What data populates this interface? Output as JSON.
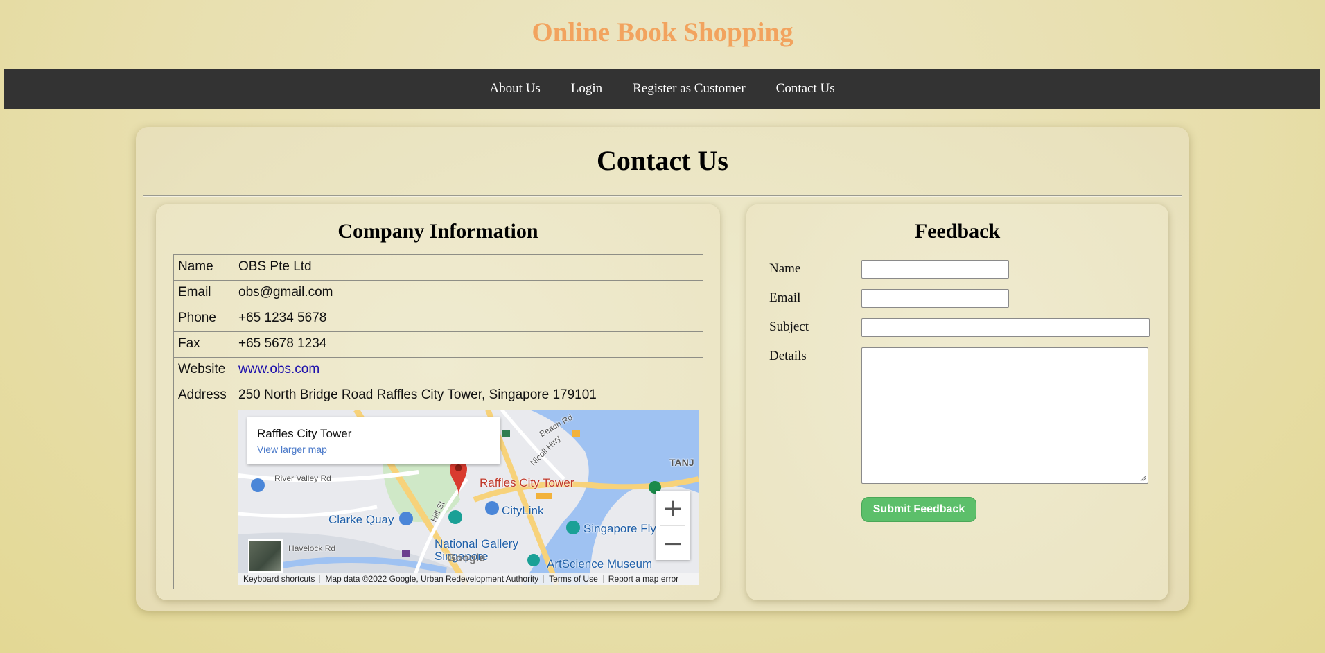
{
  "site": {
    "title": "Online Book Shopping"
  },
  "nav": {
    "items": [
      {
        "label": "About Us"
      },
      {
        "label": "Login"
      },
      {
        "label": "Register as Customer"
      },
      {
        "label": "Contact Us"
      }
    ]
  },
  "page": {
    "heading": "Contact Us"
  },
  "company": {
    "title": "Company Information",
    "rows": [
      {
        "label": "Name",
        "value": "OBS Pte Ltd"
      },
      {
        "label": "Email",
        "value": "obs@gmail.com"
      },
      {
        "label": "Phone",
        "value": "+65 1234 5678"
      },
      {
        "label": "Fax",
        "value": "+65 5678 1234"
      },
      {
        "label": "Website",
        "value": "www.obs.com"
      },
      {
        "label": "Address",
        "value": "250 North Bridge Road Raffles City Tower, Singapore 179101"
      }
    ]
  },
  "map": {
    "place_name": "Raffles City Tower",
    "larger_map_link": "View larger map",
    "labels": {
      "pin": "Raffles City Tower",
      "clarke_quay": "Clarke Quay",
      "citylink": "CityLink",
      "singapore_flyer": "Singapore Fly",
      "national_gallery": "National Gallery",
      "singapore": "Singapore",
      "artscience": "ArtScience Museum",
      "river_valley": "River Valley Rd",
      "havelock": "Havelock Rd",
      "hill_st": "Hill St",
      "nicoll": "Nicoll Hwy",
      "beach_rd": "Beach Rd",
      "tanj": "TANJ",
      "google": "Google"
    },
    "zoom_in": "+",
    "zoom_out": "−",
    "footer": {
      "shortcuts": "Keyboard shortcuts",
      "data": "Map data ©2022 Google, Urban Redevelopment Authority",
      "terms": "Terms of Use",
      "report": "Report a map error"
    }
  },
  "feedback": {
    "title": "Feedback",
    "fields": {
      "name_label": "Name",
      "email_label": "Email",
      "subject_label": "Subject",
      "details_label": "Details",
      "name_value": "",
      "email_value": "",
      "subject_value": "",
      "details_value": ""
    },
    "submit_label": "Submit Feedback"
  },
  "colors": {
    "title": "#f2a35e",
    "navbar": "#333333",
    "submit": "#5cbf6a",
    "link": "#1a0dab"
  }
}
